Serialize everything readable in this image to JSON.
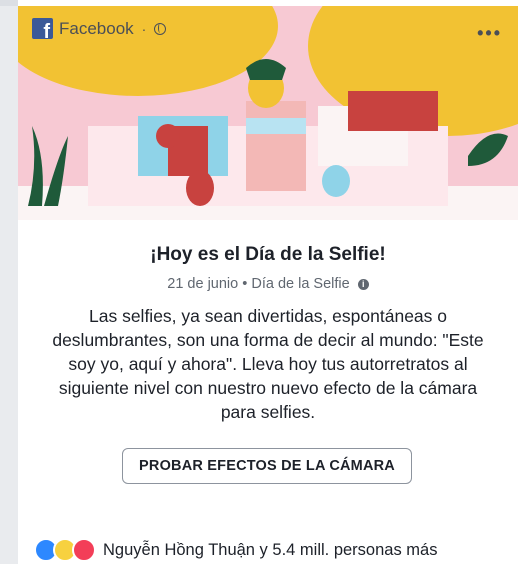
{
  "header": {
    "app_name": "Facebook",
    "separator": "·",
    "more_label": "•••"
  },
  "post": {
    "title": "¡Hoy es el Día de la Selfie!",
    "date": "21 de junio",
    "meta_separator": "•",
    "category": "Día de la Selfie",
    "info_icon_glyph": "i",
    "body": "Las selfies, ya sean divertidas, espontáneas o deslumbrantes, son una forma de decir al mundo: \"Este soy yo, aquí y ahora\". Lleva hoy tus autorretratos al siguiente nivel con nuestro nuevo efecto de la cámara para selfies.",
    "cta_label": "PROBAR EFECTOS DE LA CÁMARA"
  },
  "reactions": {
    "icons": [
      "like-icon",
      "haha-icon",
      "love-icon"
    ],
    "summary": "Nguyễn Hồng Thuận y 5.4 mill. personas más"
  },
  "colors": {
    "brand": "#3b5998",
    "hero_pink": "#f7c9d3",
    "hero_yellow": "#f2c233",
    "hero_green": "#1f5a3a",
    "hero_red": "#c8423f",
    "hero_blue": "#8fd3e8"
  }
}
